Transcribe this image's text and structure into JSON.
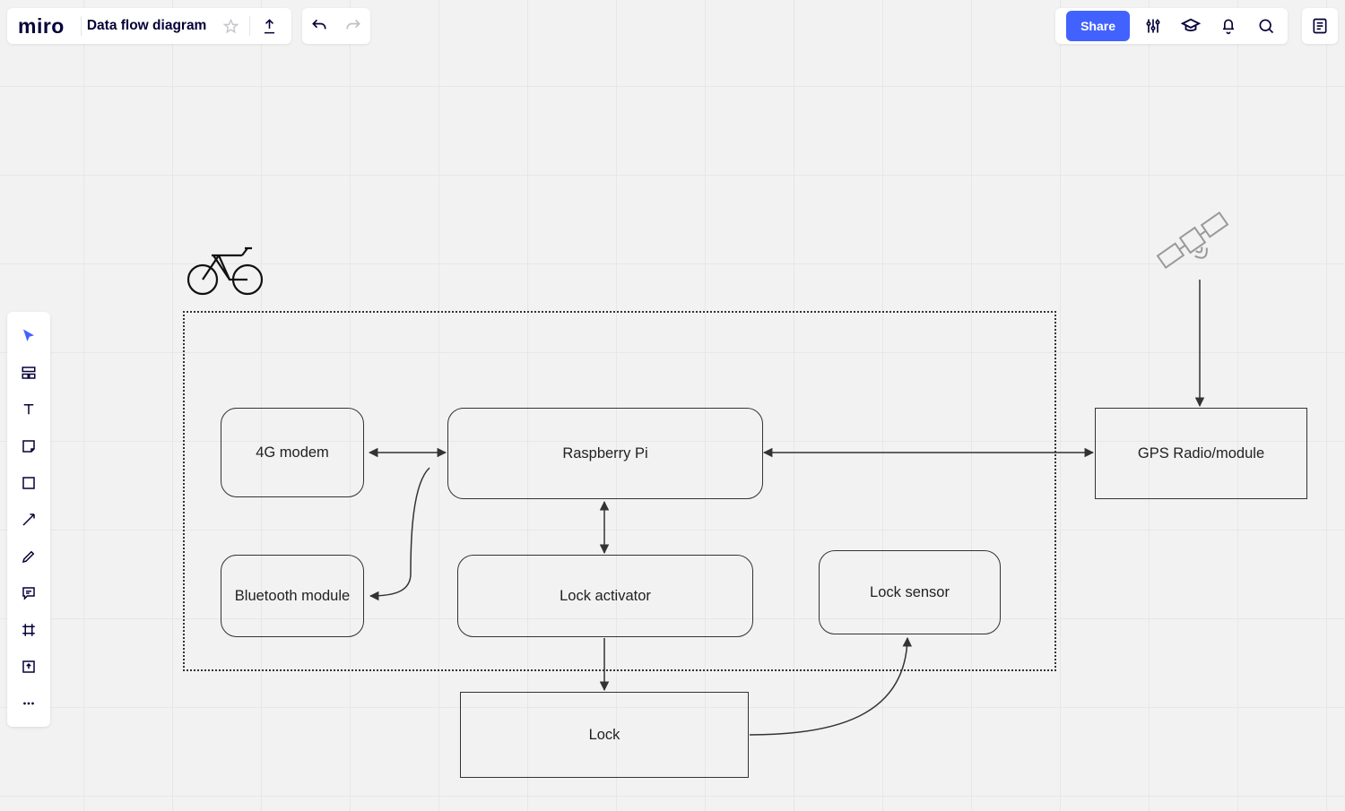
{
  "app": {
    "logo_text": "miro",
    "board_title": "Data flow diagram",
    "share_label": "Share"
  },
  "diagram": {
    "container_label": "",
    "nodes": {
      "modem_4g": "4G modem",
      "raspberry_pi": "Raspberry Pi",
      "gps_module": "GPS Radio/module",
      "bluetooth": "Bluetooth module",
      "lock_activator": "Lock activator",
      "lock_sensor": "Lock sensor",
      "lock": "Lock"
    },
    "edges": [
      {
        "from": "modem_4g",
        "to": "raspberry_pi",
        "bidirectional": true
      },
      {
        "from": "raspberry_pi",
        "to": "gps_module",
        "bidirectional": true
      },
      {
        "from": "satellite",
        "to": "gps_module",
        "bidirectional": false
      },
      {
        "from": "raspberry_pi",
        "to": "lock_activator",
        "bidirectional": true
      },
      {
        "from": "raspberry_pi",
        "to": "bluetooth",
        "via_curve_near": "modem_4g",
        "bidirectional": false
      },
      {
        "from": "lock_activator",
        "to": "lock",
        "bidirectional": false
      },
      {
        "from": "lock",
        "to": "lock_sensor",
        "via_curve": true,
        "bidirectional": false
      }
    ],
    "icons": {
      "bike": "bicycle-icon",
      "satellite": "satellite-icon"
    }
  }
}
